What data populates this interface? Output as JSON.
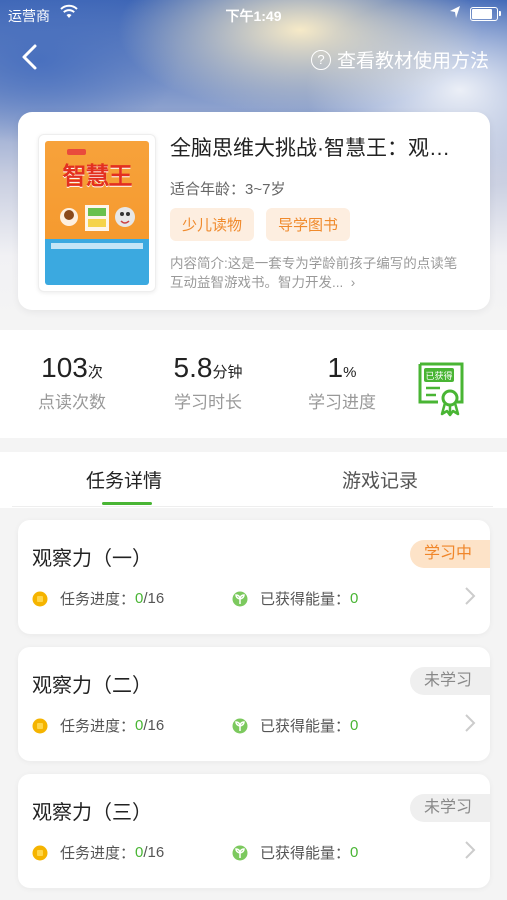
{
  "status_bar": {
    "carrier": "运营商",
    "time": "下午1:49"
  },
  "header": {
    "guide_label": "查看教材使用方法"
  },
  "book": {
    "title": "全脑思维大挑战·智慧王：观察力",
    "age": "适合年龄：3~7岁",
    "tags": [
      "少儿读物",
      "导学图书"
    ],
    "description": "内容简介:这是一套专为学龄前孩子编写的点读笔互动益智游戏书。智力开发...",
    "cover_title": "智慧王"
  },
  "stats": [
    {
      "value": "103",
      "unit": "次",
      "label": "点读次数"
    },
    {
      "value": "5.8",
      "unit": "分钟",
      "label": "学习时长"
    },
    {
      "value": "1",
      "unit": "%",
      "label": "学习进度"
    }
  ],
  "certificate": {
    "label": "已获得"
  },
  "tabs": [
    {
      "label": "任务详情",
      "active": true
    },
    {
      "label": "游戏记录",
      "active": false
    }
  ],
  "tasks": [
    {
      "title": "观察力（一）",
      "status": "学习中",
      "progress_label": "任务进度：",
      "progress_done": "0",
      "progress_total": "/16",
      "energy_label": "已获得能量：",
      "energy": "0"
    },
    {
      "title": "观察力（二）",
      "status": "未学习",
      "progress_label": "任务进度：",
      "progress_done": "0",
      "progress_total": "/16",
      "energy_label": "已获得能量：",
      "energy": "0"
    },
    {
      "title": "观察力（三）",
      "status": "未学习",
      "progress_label": "任务进度：",
      "progress_done": "0",
      "progress_total": "/16",
      "energy_label": "已获得能量：",
      "energy": "0"
    }
  ],
  "colors": {
    "accent_green": "#49b534",
    "accent_orange": "#f0862a",
    "tag_bg": "#fdeee0"
  }
}
